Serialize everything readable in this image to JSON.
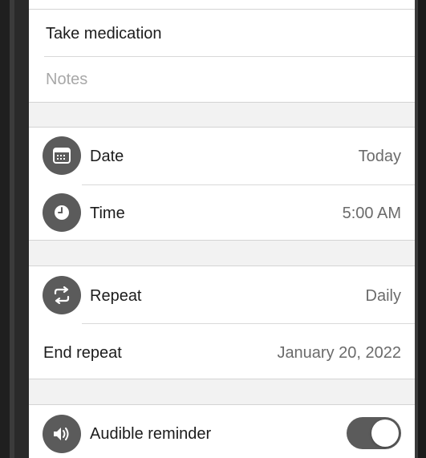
{
  "task": {
    "title": "Take medication",
    "notes_placeholder": "Notes"
  },
  "schedule": {
    "date_label": "Date",
    "date_value": "Today",
    "time_label": "Time",
    "time_value": "5:00 AM"
  },
  "repeat": {
    "repeat_label": "Repeat",
    "repeat_value": "Daily",
    "end_label": "End repeat",
    "end_value": "January 20, 2022"
  },
  "reminder": {
    "audible_label": "Audible reminder",
    "audible_on": true
  },
  "colors": {
    "icon_bg": "#5b5b5b",
    "toggle_on": "#5b5b5b"
  },
  "icons": [
    "calendar-icon",
    "clock-icon",
    "repeat-icon",
    "speaker-icon"
  ]
}
